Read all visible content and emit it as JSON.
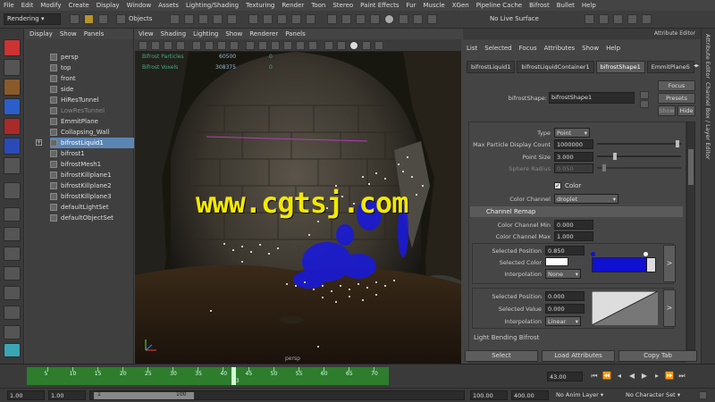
{
  "menubar": [
    "File",
    "Edit",
    "Modify",
    "Create",
    "Display",
    "Window",
    "Assets",
    "Lighting/Shading",
    "Texturing",
    "Render",
    "Toon",
    "Stereo",
    "Paint Effects",
    "Fur",
    "Muscle",
    "XGen",
    "Pipeline Cache",
    "Bifrost",
    "Bullet",
    "Help"
  ],
  "shelf": {
    "menu_set": "Rendering",
    "objects_label": "Objects",
    "live_surface": "No Live Surface"
  },
  "outliner": {
    "menu": [
      "Display",
      "Show",
      "Panels"
    ],
    "items": [
      {
        "label": "persp",
        "state": "normal"
      },
      {
        "label": "top",
        "state": "normal"
      },
      {
        "label": "front",
        "state": "normal"
      },
      {
        "label": "side",
        "state": "normal"
      },
      {
        "label": "HiResTunnel",
        "state": "normal"
      },
      {
        "label": "LowResTunnel",
        "state": "dim"
      },
      {
        "label": "EmmitPlane",
        "state": "normal"
      },
      {
        "label": "Collapsing_Wall",
        "state": "normal"
      },
      {
        "label": "bifrostLiquid1",
        "state": "selected"
      },
      {
        "label": "bifrost1",
        "state": "normal"
      },
      {
        "label": "bifrostMesh1",
        "state": "normal"
      },
      {
        "label": "bifrostKillplane1",
        "state": "normal"
      },
      {
        "label": "bifrostKillplane2",
        "state": "normal"
      },
      {
        "label": "bifrostKillplane3",
        "state": "normal"
      },
      {
        "label": "defaultLightSet",
        "state": "normal"
      },
      {
        "label": "defaultObjectSet",
        "state": "normal"
      }
    ]
  },
  "viewport": {
    "menu": [
      "View",
      "Shading",
      "Lighting",
      "Show",
      "Renderer",
      "Panels"
    ],
    "hud": [
      {
        "label": "Bifrost Particles",
        "value": "60500",
        "extra": "0"
      },
      {
        "label": "Bifrost Voxels",
        "value": "308375",
        "extra": "0"
      }
    ],
    "camera_label": "persp",
    "watermark": "www.cgtsj.com"
  },
  "attribute_editor": {
    "title": "Attribute Editor",
    "menu": [
      "List",
      "Selected",
      "Focus",
      "Attributes",
      "Show",
      "Help"
    ],
    "tabs": [
      "bifrostLiquid1",
      "bifrostLiquidContainer1",
      "bifrostShape1",
      "EmmitPlaneS"
    ],
    "active_tab": "bifrostShape1",
    "shape_label": "bifrostShape:",
    "shape_value": "bifrostShape1",
    "focus_btn": "Focus",
    "presets_btn": "Presets",
    "show_btn": "Show",
    "hide_btn": "Hide",
    "type_label": "Type",
    "type_value": "Point",
    "max_particle_label": "Max Particle Display Count",
    "max_particle_value": "1000000",
    "point_size_label": "Point Size",
    "point_size_value": "3.000",
    "sphere_radius_label": "Sphere Radius",
    "sphere_radius_value": "0.050",
    "color_label": "Color",
    "color_channel_label": "Color Channel",
    "color_channel_value": "droplet",
    "section_title": "Channel Remap",
    "channel_min_label": "Color Channel Min",
    "channel_min_value": "0.000",
    "channel_max_label": "Color Channel Max",
    "channel_max_value": "1.000",
    "ramp1": {
      "sel_pos_label": "Selected Position",
      "sel_pos_value": "0.850",
      "sel_color_label": "Selected Color",
      "interp_label": "Interpolation",
      "interp_value": "None",
      "ramp_color": "#1010d0"
    },
    "ramp2": {
      "sel_pos_label": "Selected Position",
      "sel_pos_value": "0.000",
      "sel_value_label": "Selected Value",
      "sel_value_value": "0.000",
      "interp_label": "Interpolation",
      "interp_value": "Linear"
    },
    "arrow": ">",
    "next_section": "Light Bending Bifrost",
    "select_btn": "Select",
    "load_btn": "Load Attributes",
    "copy_btn": "Copy Tab"
  },
  "side_tabs": [
    "Channel Box / Layer Editor",
    "Attribute Editor"
  ],
  "timeline": {
    "ticks": [
      "5",
      "10",
      "15",
      "20",
      "25",
      "30",
      "35",
      "40",
      "45",
      "50",
      "55",
      "60",
      "65",
      "70"
    ],
    "current": "43",
    "current_frame_field": "43.00"
  },
  "range": {
    "start": "1.00",
    "start2": "1.00",
    "range_start": "1",
    "range_end": "100",
    "end": "100.00",
    "end2": "400.00",
    "anim_layer": "No Anim Layer",
    "character_set": "No Character Set"
  }
}
